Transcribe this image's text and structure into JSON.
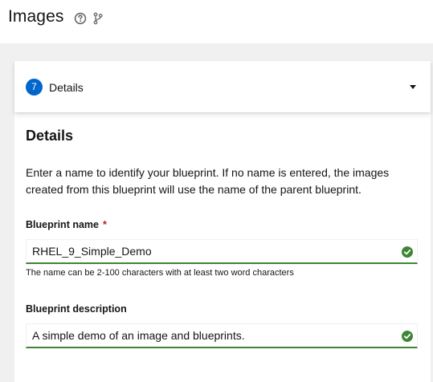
{
  "header": {
    "title": "Images"
  },
  "wizard": {
    "step_number": "7",
    "step_label": "Details"
  },
  "details": {
    "title": "Details",
    "intro": "Enter a name to identify your blueprint. If no name is entered, the images created from this blueprint will use the name of the parent blueprint.",
    "name_label": "Blueprint name",
    "required_mark": "*",
    "name_value": "RHEL_9_Simple_Demo",
    "name_helper": "The name can be 2-100 characters with at least two word characters",
    "description_label": "Blueprint description",
    "description_value": "A simple demo of an image and blueprints."
  },
  "colors": {
    "accent": "#0066cc",
    "success": "#3e8635",
    "required": "#c9190b"
  },
  "icons": {
    "help": "question-circle-icon",
    "branch": "code-branch-icon",
    "caret": "caret-down-icon",
    "valid": "check-circle-icon"
  }
}
